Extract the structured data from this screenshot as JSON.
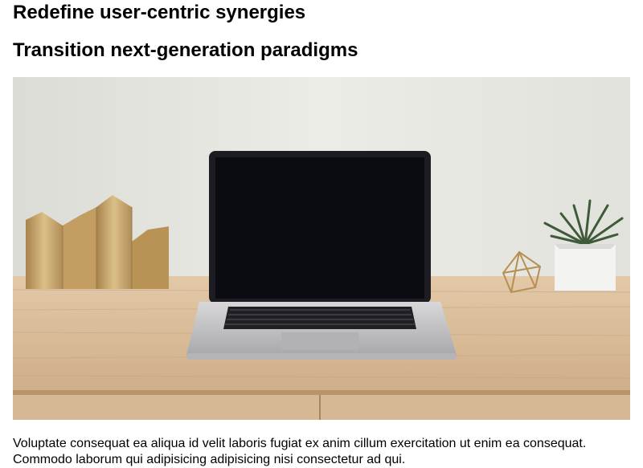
{
  "headline": "Redefine user-centric synergies",
  "subheadline": "Transition next-generation paradigms",
  "hero_image": {
    "subject": "laptop on wooden desk with brass vases, geometric ornament and potted succulent"
  },
  "body_text": "Voluptate consequat ea aliqua id velit laboris fugiat ex anim cillum exercitation ut enim ea consequat. Commodo laborum qui adipisicing adipisicing nisi consectetur ad qui.",
  "colors": {
    "wall": "#e6e6e1",
    "desk": "#d8bc9a",
    "laptop_silver": "#c9c9cb",
    "screen": "#0b0b12",
    "brass": "#c9a46a",
    "pot": "#f2f2f0",
    "plant": "#3f5a3a"
  }
}
